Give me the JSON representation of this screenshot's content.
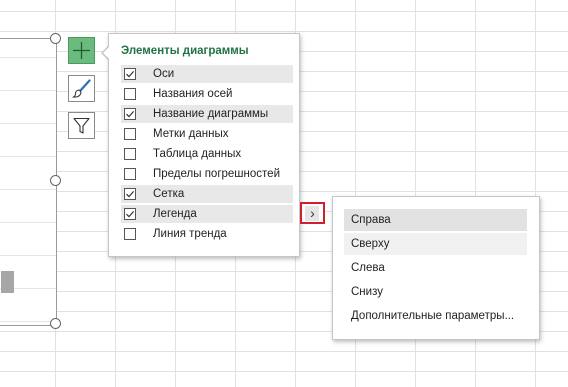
{
  "popup": {
    "title": "Элементы диаграммы",
    "items": [
      {
        "label": "Оси",
        "checked": true
      },
      {
        "label": "Названия осей",
        "checked": false
      },
      {
        "label": "Название диаграммы",
        "checked": true
      },
      {
        "label": "Метки данных",
        "checked": false
      },
      {
        "label": "Таблица данных",
        "checked": false
      },
      {
        "label": "Пределы погрешностей",
        "checked": false
      },
      {
        "label": "Сетка",
        "checked": true
      },
      {
        "label": "Легенда",
        "checked": true
      },
      {
        "label": "Линия тренда",
        "checked": false
      }
    ]
  },
  "side_buttons": [
    {
      "name": "chart-elements-button",
      "icon": "plus-icon"
    },
    {
      "name": "chart-styles-button",
      "icon": "paintbrush-icon"
    },
    {
      "name": "chart-filters-button",
      "icon": "funnel-icon"
    }
  ],
  "submenu": {
    "arrow": "›",
    "items": [
      {
        "label": "Справа"
      },
      {
        "label": "Сверху"
      },
      {
        "label": "Слева"
      },
      {
        "label": "Снизу"
      },
      {
        "label": "Дополнительные параметры..."
      }
    ]
  },
  "colors": {
    "accent": "#217346",
    "active_button": "#6cbb7e",
    "highlight_border": "#d11f2b"
  }
}
